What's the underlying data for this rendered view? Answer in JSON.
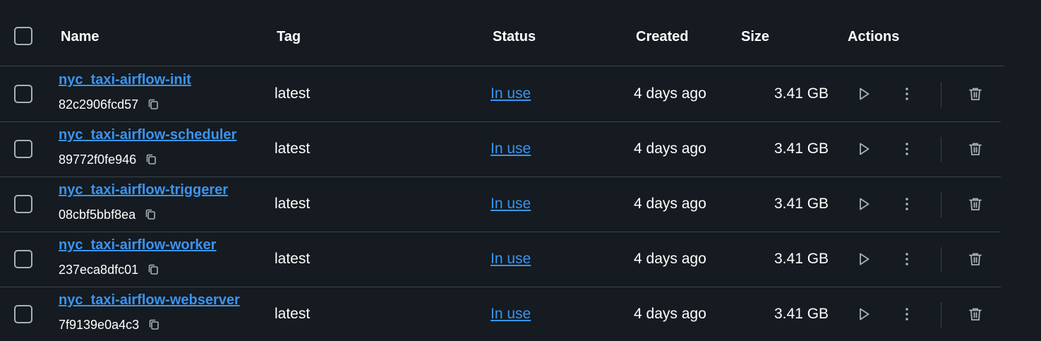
{
  "header": {
    "name": "Name",
    "tag": "Tag",
    "status": "Status",
    "created": "Created",
    "size": "Size",
    "actions": "Actions"
  },
  "colors": {
    "background": "#151b20",
    "link": "#3b94f0",
    "icon": "#a8b2bb",
    "divider": "#3a444c"
  },
  "icons": [
    "checkbox-icon",
    "copy-icon",
    "play-icon",
    "more-vertical-icon",
    "trash-icon"
  ],
  "rows": [
    {
      "name": "nyc_taxi-airflow-init",
      "id": "82c2906fcd57",
      "tag": "latest",
      "status": "In use",
      "created": "4 days ago",
      "size": "3.41 GB"
    },
    {
      "name": "nyc_taxi-airflow-scheduler",
      "id": "89772f0fe946",
      "tag": "latest",
      "status": "In use",
      "created": "4 days ago",
      "size": "3.41 GB"
    },
    {
      "name": "nyc_taxi-airflow-triggerer",
      "id": "08cbf5bbf8ea",
      "tag": "latest",
      "status": "In use",
      "created": "4 days ago",
      "size": "3.41 GB"
    },
    {
      "name": "nyc_taxi-airflow-worker",
      "id": "237eca8dfc01",
      "tag": "latest",
      "status": "In use",
      "created": "4 days ago",
      "size": "3.41 GB"
    },
    {
      "name": "nyc_taxi-airflow-webserver",
      "id": "7f9139e0a4c3",
      "tag": "latest",
      "status": "In use",
      "created": "4 days ago",
      "size": "3.41 GB"
    }
  ]
}
